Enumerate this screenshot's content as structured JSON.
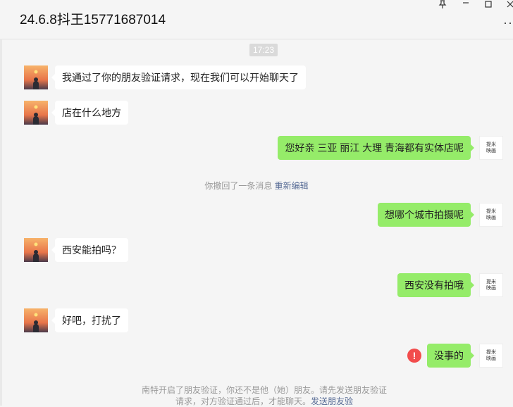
{
  "header": {
    "title": "24.6.8抖王15771687014",
    "pin_icon": "pin-icon",
    "minimize_icon": "minimize-icon",
    "maximize_icon": "maximize-icon",
    "close_icon": "close-icon",
    "more_icon": "more-icon"
  },
  "timestamp": "17:23",
  "messages": [
    {
      "side": "left",
      "text": "我通过了你的朋友验证请求，现在我们可以开始聊天了"
    },
    {
      "side": "left",
      "text": "店在什么地方"
    },
    {
      "side": "right",
      "text": "您好亲 三亚 丽江 大理 青海都有实体店呢"
    },
    {
      "side": "right",
      "text": "想哪个城市拍摄呢"
    },
    {
      "side": "left",
      "text": "西安能拍吗？"
    },
    {
      "side": "right",
      "text": "西安没有拍哦"
    },
    {
      "side": "left",
      "text": "好吧，打扰了"
    },
    {
      "side": "right",
      "text": "没事的",
      "status": "failed"
    }
  ],
  "recall_notice": {
    "text": "你撤回了一条消息",
    "action": "重新编辑"
  },
  "self_avatar_text": "提米\n映画",
  "footer": {
    "text": "南特开启了朋友验证，你还不是他（她）朋友。请先发送朋友验证请求，对方验证通过后，才能聊天。",
    "link": "发送朋友验"
  },
  "colors": {
    "outgoing_bubble": "#95ec69",
    "incoming_bubble": "#ffffff",
    "error": "#f24c4c",
    "link": "#576b95"
  }
}
